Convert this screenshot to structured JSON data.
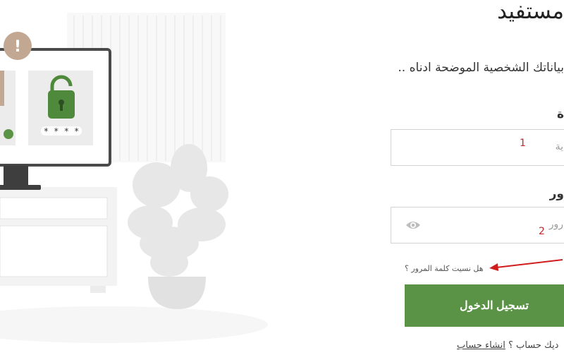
{
  "header": {
    "title": "مستفيد",
    "subtitle": "بياناتك الشخصية الموضحة ادناه .."
  },
  "form": {
    "username": {
      "label": "ة",
      "placeholder": "ية",
      "marker": "1"
    },
    "password": {
      "label": "ور",
      "placeholder": "رور",
      "marker": "2"
    },
    "forgot_link": "هل نسيت كلمة المرور ؟",
    "submit_label": "تسجيل الدخول",
    "signup": {
      "prompt": "ديك حساب ؟",
      "link_label": "انشاء حساب"
    }
  },
  "illustration": {
    "password_mask": "* * * *",
    "alert_symbol": "!"
  },
  "colors": {
    "accent": "#5a9346",
    "lock": "#4f8a3c",
    "alert": "#c2a892",
    "annotation": "#c1272d"
  },
  "icons": [
    "alert-icon",
    "lock-icon",
    "eye-icon",
    "arrow-icon"
  ]
}
